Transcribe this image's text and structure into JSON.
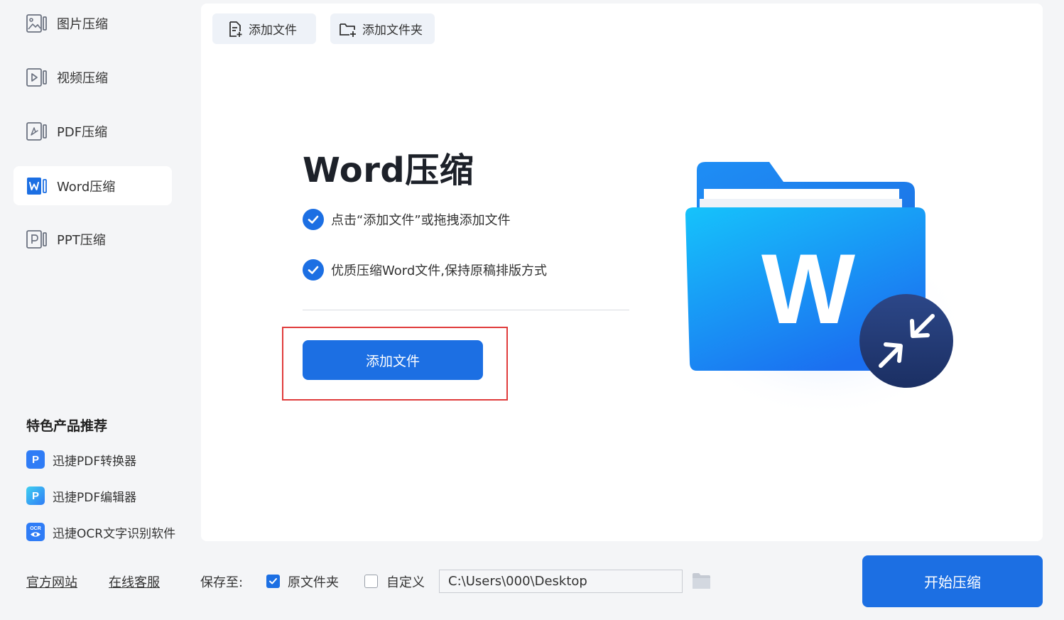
{
  "sidebar": {
    "items": [
      {
        "label": "图片压缩",
        "icon": "image-compress-icon"
      },
      {
        "label": "视频压缩",
        "icon": "video-compress-icon"
      },
      {
        "label": "PDF压缩",
        "icon": "pdf-compress-icon"
      },
      {
        "label": "Word压缩",
        "icon": "word-compress-icon"
      },
      {
        "label": "PPT压缩",
        "icon": "ppt-compress-icon"
      }
    ],
    "active_item": "Word压缩",
    "featured_title": "特色产品推荐",
    "featured": [
      {
        "label": "迅捷PDF转换器",
        "icon": "pdf-converter-app-icon",
        "glyph": "P"
      },
      {
        "label": "迅捷PDF编辑器",
        "icon": "pdf-editor-app-icon",
        "glyph": "P"
      },
      {
        "label": "迅捷OCR文字识别软件",
        "icon": "ocr-app-icon",
        "glyph": "OCR"
      }
    ]
  },
  "toolbar": {
    "add_file_label": "添加文件",
    "add_folder_label": "添加文件夹"
  },
  "main": {
    "headline": "Word压缩",
    "features": [
      "点击“添加文件”或拖拽添加文件",
      "优质压缩Word文件,保持原稿排版方式"
    ],
    "add_file_button": "添加文件",
    "illustration_letter": "W"
  },
  "footer": {
    "official_site": "官方网站",
    "online_service": "在线客服",
    "save_to_label": "保存至:",
    "original_folder_label": "原文件夹",
    "original_folder_checked": true,
    "custom_label": "自定义",
    "custom_checked": false,
    "output_path": "C:\\Users\\000\\Desktop",
    "start_button": "开始压缩"
  },
  "colors": {
    "accent": "#1c6fe3",
    "highlight_border": "#e03c3c",
    "background": "#f4f5f7",
    "panel": "#ffffff"
  }
}
